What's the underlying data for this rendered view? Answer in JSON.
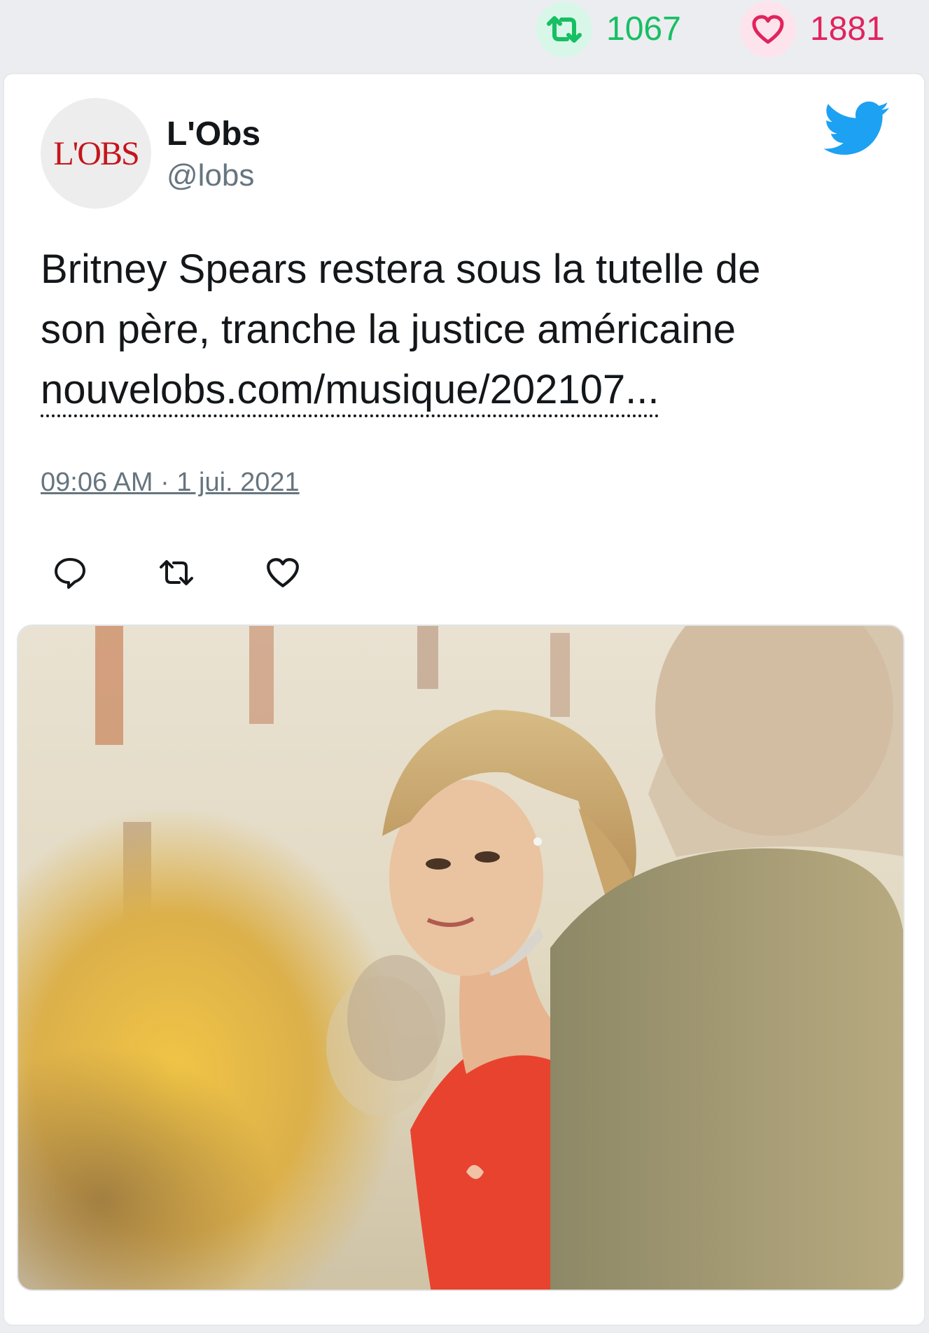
{
  "stats": {
    "retweet_count": "1067",
    "like_count": "1881"
  },
  "tweet": {
    "author_name": "L'Obs",
    "author_handle": "@lobs",
    "avatar_text": "L'OBS",
    "text_line_1": "Britney Spears restera sous la tutelle de",
    "text_line_2": "son père, tranche la justice américaine",
    "link_text": "nouvelobs.com/musique/202107...",
    "timestamp": "09:06 AM · 1 jui. 2021"
  },
  "icons": {
    "platform": "twitter-bird-icon",
    "reply": "reply-icon",
    "retweet": "retweet-icon",
    "like": "heart-icon"
  },
  "colors": {
    "retweet_green": "#17bf63",
    "like_red": "#e0245e",
    "twitter_blue": "#1da1f2",
    "dress_red": "#e8432f"
  }
}
